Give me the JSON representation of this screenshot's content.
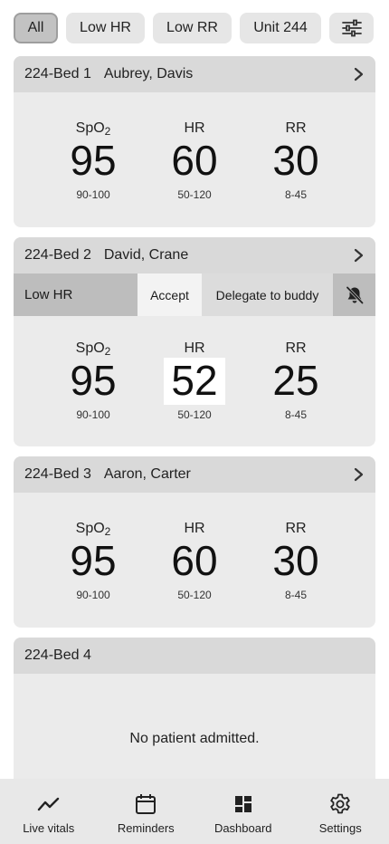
{
  "filters": [
    {
      "label": "All",
      "active": true
    },
    {
      "label": "Low HR",
      "active": false
    },
    {
      "label": "Low RR",
      "active": false
    },
    {
      "label": "Unit 244",
      "active": false
    }
  ],
  "filter_settings_icon": "sliders-icon",
  "patients": [
    {
      "bed": "224-Bed 1",
      "name": "Aubrey, Davis",
      "vitals": [
        {
          "label": "SpO",
          "sub": "2",
          "value": "95",
          "range": "90-100"
        },
        {
          "label": "HR",
          "value": "60",
          "range": "50-120"
        },
        {
          "label": "RR",
          "value": "30",
          "range": "8-45"
        }
      ]
    },
    {
      "bed": "224-Bed 2",
      "name": "David, Crane",
      "alert": {
        "label": "Low HR",
        "accept": "Accept",
        "delegate": "Delegate to buddy",
        "mute_icon": "bell-off-icon"
      },
      "vitals": [
        {
          "label": "SpO",
          "sub": "2",
          "value": "95",
          "range": "90-100"
        },
        {
          "label": "HR",
          "value": "52",
          "range": "50-120",
          "highlight": true
        },
        {
          "label": "RR",
          "value": "25",
          "range": "8-45"
        }
      ]
    },
    {
      "bed": "224-Bed 3",
      "name": "Aaron, Carter",
      "vitals": [
        {
          "label": "SpO",
          "sub": "2",
          "value": "95",
          "range": "90-100"
        },
        {
          "label": "HR",
          "value": "60",
          "range": "50-120"
        },
        {
          "label": "RR",
          "value": "30",
          "range": "8-45"
        }
      ]
    },
    {
      "bed": "224-Bed 4",
      "empty_message": "No patient admitted."
    }
  ],
  "nav": [
    {
      "label": "Live vitals",
      "icon": "trend-line-icon"
    },
    {
      "label": "Reminders",
      "icon": "calendar-icon"
    },
    {
      "label": "Dashboard",
      "icon": "dashboard-grid-icon"
    },
    {
      "label": "Settings",
      "icon": "gear-icon"
    }
  ]
}
